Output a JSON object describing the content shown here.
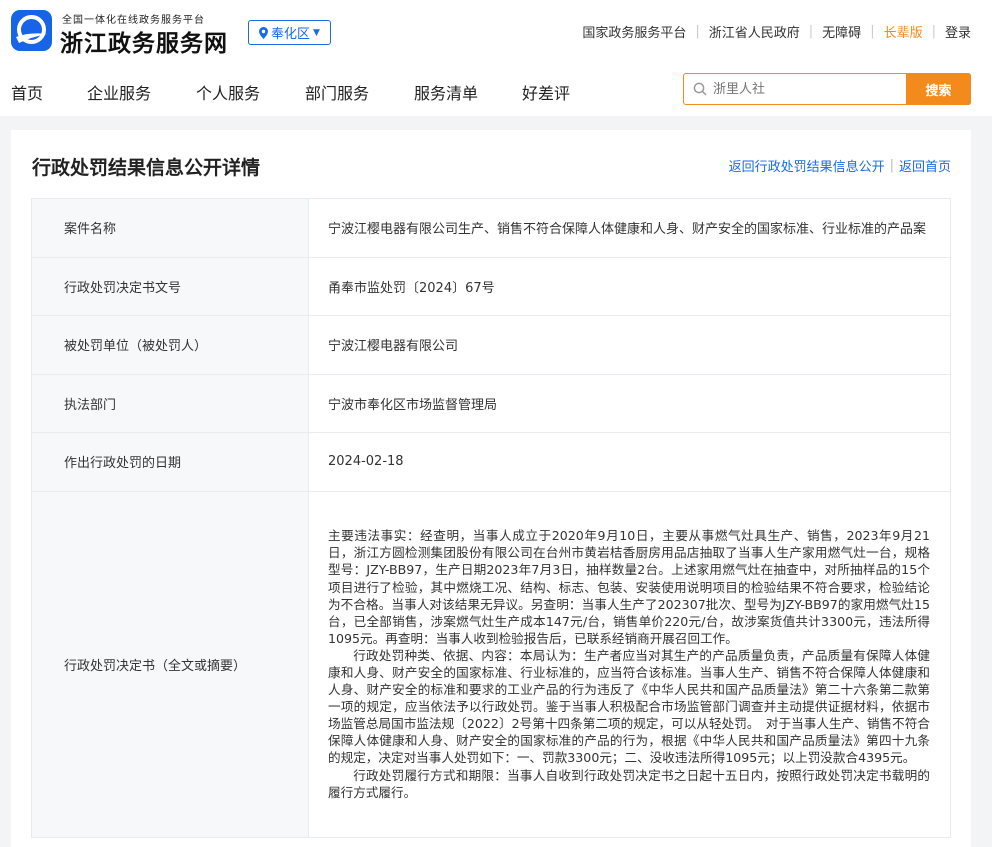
{
  "header": {
    "logo_subtitle": "全国一体化在线政务服务平台",
    "logo_title": "浙江政务服务网",
    "region": "奉化区",
    "top_links": [
      "国家政务服务平台",
      "浙江省人民政府",
      "无障碍",
      "长辈版",
      "登录"
    ],
    "accent_color": "#f28a1c",
    "brand_color": "#1764e8"
  },
  "nav": {
    "items": [
      "首页",
      "企业服务",
      "个人服务",
      "部门服务",
      "服务清单",
      "好差评"
    ],
    "search_placeholder": "浙里人社",
    "search_button": "搜索"
  },
  "page": {
    "title": "行政处罚结果信息公开详情",
    "back_list": "返回行政处罚结果信息公开",
    "back_home": "返回首页"
  },
  "details": [
    {
      "label": "案件名称",
      "value": "宁波江樱电器有限公司生产、销售不符合保障人体健康和人身、财产安全的国家标准、行业标准的产品案"
    },
    {
      "label": "行政处罚决定书文号",
      "value": "甬奉市监处罚〔2024〕67号"
    },
    {
      "label": "被处罚单位（被处罚人）",
      "value": "宁波江樱电器有限公司"
    },
    {
      "label": "执法部门",
      "value": "宁波市奉化区市场监督管理局"
    },
    {
      "label": "作出行政处罚的日期",
      "value": "2024-02-18"
    }
  ],
  "decision": {
    "label": "行政处罚决定书（全文或摘要）",
    "paragraphs": [
      "主要违法事实：经查明，当事人成立于2020年9月10日，主要从事燃气灶具生产、销售，2023年9月21日，浙江方圆检测集团股份有限公司在台州市黄岩桔香厨房用品店抽取了当事人生产家用燃气灶一台，规格型号：JZY-BB97，生产日期2023年7月3日，抽样数量2台。上述家用燃气灶在抽查中，对所抽样品的15个项目进行了检验，其中燃烧工况、结构、标志、包装、安装使用说明项目的检验结果不符合要求，检验结论为不合格。当事人对该结果无异议。另查明：当事人生产了202307批次、型号为JZY-BB97的家用燃气灶15台，已全部销售，涉案燃气灶生产成本147元/台，销售单价220元/台，故涉案货值共计3300元，违法所得1095元。再查明：当事人收到检验报告后，已联系经销商开展召回工作。",
      "行政处罚种类、依据、内容：本局认为：生产者应当对其生产的产品质量负责，产品质量有保障人体健康和人身、财产安全的国家标准、行业标准的，应当符合该标准。当事人生产、销售不符合保障人体健康和人身、财产安全的标准和要求的工业产品的行为违反了《中华人民共和国产品质量法》第二十六条第二款第一项的规定，应当依法予以行政处罚。鉴于当事人积极配合市场监管部门调查并主动提供证据材料，依据市场监管总局国市监法规〔2022〕2号第十四条第二项的规定，可以从轻处罚。　对于当事人生产、销售不符合保障人体健康和人身、财产安全的国家标准的产品的行为，根据《中华人民共和国产品质量法》第四十九条的规定，决定对当事人处罚如下：一、罚款3300元；二、没收违法所得1095元；以上罚没款合4395元。",
      "行政处罚履行方式和期限：当事人自收到行政处罚决定书之日起十五日内，按照行政处罚决定书载明的履行方式履行。"
    ]
  }
}
